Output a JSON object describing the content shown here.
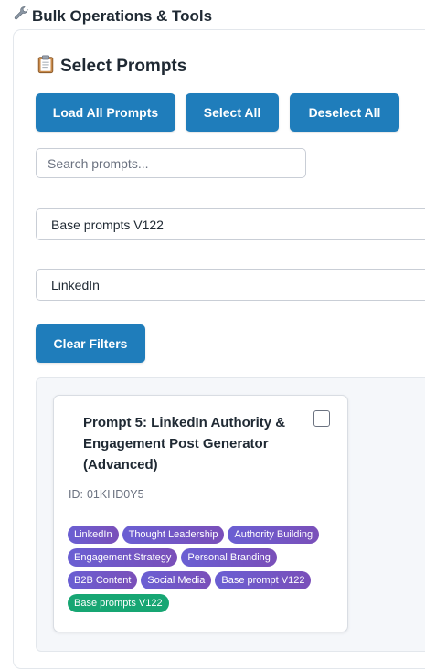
{
  "page": {
    "heading_icon": "wrench-icon",
    "heading": "Bulk Operations & Tools"
  },
  "panel": {
    "title_icon": "clipboard-icon",
    "title": "Select Prompts",
    "buttons": {
      "load_all": "Load All Prompts",
      "select_all": "Select All",
      "deselect_all": "Deselect All",
      "clear_filters": "Clear Filters"
    },
    "search": {
      "placeholder": "Search prompts...",
      "value": ""
    },
    "filters": {
      "category": "Base prompts V122",
      "platform": "LinkedIn"
    }
  },
  "prompts": [
    {
      "title": "Prompt 5: LinkedIn Authority & Engagement Post Generator (Advanced)",
      "id_label": "ID:",
      "id": "01KHD0Y5",
      "checked": false,
      "tags": [
        {
          "label": "LinkedIn",
          "style": "purple"
        },
        {
          "label": "Thought Leadership",
          "style": "purple"
        },
        {
          "label": "Authority Building",
          "style": "purple"
        },
        {
          "label": "Engagement Strategy",
          "style": "purple"
        },
        {
          "label": "Personal Branding",
          "style": "purple"
        },
        {
          "label": "B2B Content",
          "style": "purple"
        },
        {
          "label": "Social Media",
          "style": "purple"
        },
        {
          "label": "Base prompt V122",
          "style": "purple"
        },
        {
          "label": "Base prompts V122",
          "style": "green"
        }
      ]
    }
  ],
  "colors": {
    "primary_button": "#1f7dbb",
    "tag_purple_start": "#6a5fd3",
    "tag_purple_end": "#7a4fb9",
    "tag_green": "#17a673"
  }
}
